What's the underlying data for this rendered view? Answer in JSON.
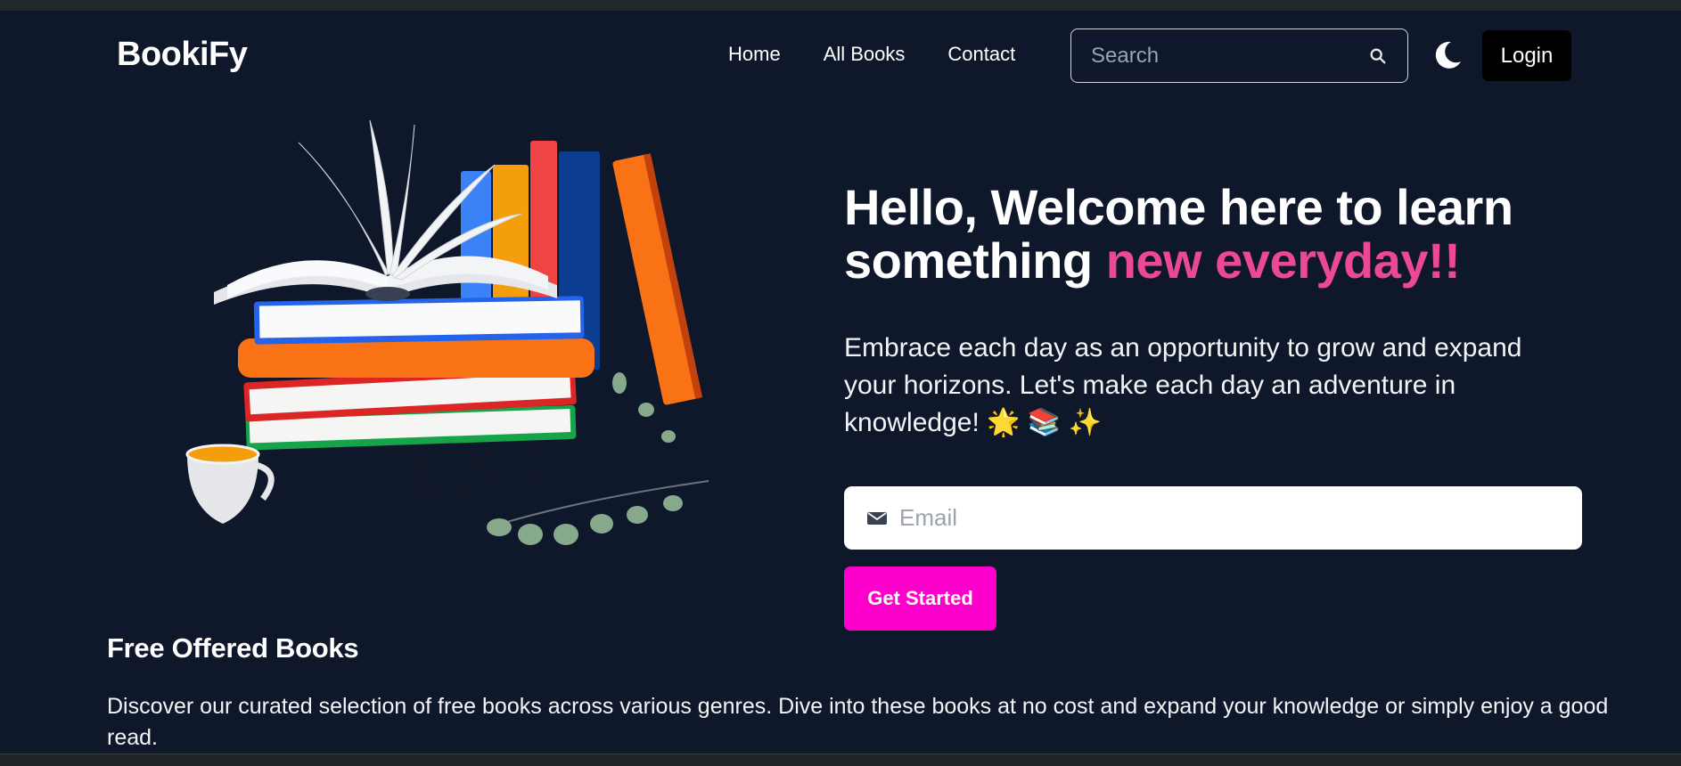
{
  "nav": {
    "logo": "BookiFy",
    "links": [
      "Home",
      "All Books",
      "Contact"
    ],
    "search_placeholder": "Search",
    "login_label": "Login"
  },
  "hero": {
    "title_part1": "Hello, Welcome here to learn something ",
    "title_highlight": "new everyday!!",
    "description": "Embrace each day as an opportunity to grow and expand your horizons. Let's make each day an adventure in knowledge! 🌟 📚 ✨",
    "email_placeholder": "Email",
    "cta_label": "Get Started"
  },
  "free_books": {
    "title": "Free Offered Books",
    "description": "Discover our curated selection of free books across various genres. Dive into these books at no cost and expand your knowledge or simply enjoy a good read."
  },
  "icons": {
    "search": "search-icon",
    "theme": "moon-icon",
    "email": "envelope-icon"
  },
  "colors": {
    "background": "#0f172a",
    "accent_pink": "#ec4899",
    "cta_magenta": "#ff00cc",
    "login_bg": "#000000"
  }
}
